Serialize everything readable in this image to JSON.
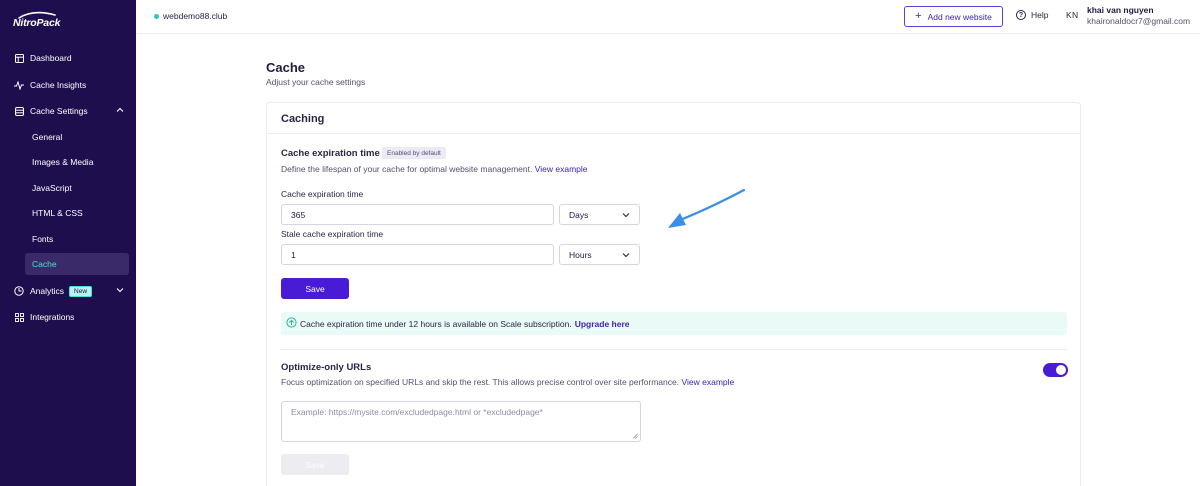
{
  "sidebar": {
    "logo": "NitroPack",
    "items": [
      {
        "label": "Dashboard",
        "icon": "dashboard-icon"
      },
      {
        "label": "Cache Insights",
        "icon": "pulse-icon"
      },
      {
        "label": "Cache Settings",
        "icon": "database-icon"
      },
      {
        "label": "Analytics",
        "icon": "clock-chart-icon",
        "badge": "New"
      },
      {
        "label": "Integrations",
        "icon": "grid-icon"
      }
    ],
    "subitems": [
      "General",
      "Images & Media",
      "JavaScript",
      "HTML & CSS",
      "Fonts",
      "Cache"
    ],
    "active_subitem": "Cache"
  },
  "topbar": {
    "site": "webdemo88.club",
    "add_website": "Add new website",
    "help": "Help",
    "avatar_initials": "KN",
    "user_name": "khai van nguyen",
    "user_email": "khaironaldocr7@gmail.com"
  },
  "page": {
    "title": "Cache",
    "subtitle": "Adjust your cache settings"
  },
  "caching": {
    "title": "Caching",
    "expiration_title": "Cache expiration time",
    "enabled_badge": "Enabled by default",
    "expiration_desc": "Define the lifespan of your cache for optimal website management.",
    "view_example": "View example",
    "expiration_label": "Cache expiration time",
    "expiration_value": "365",
    "expiration_unit": "Days",
    "stale_label": "Stale cache expiration time",
    "stale_value": "1",
    "stale_unit": "Hours",
    "save": "Save",
    "info_text": "Cache expiration time under 12 hours is available on Scale subscription.",
    "upgrade": "Upgrade here"
  },
  "optimize_only": {
    "title": "Optimize-only URLs",
    "desc": "Focus optimization on specified URLs and skip the rest. This allows precise control over site performance.",
    "view_example": "View example",
    "placeholder": "Example: https://mysite.com/excludedpage.html or *excludedpage*",
    "save": "Save",
    "toggle_on": true
  },
  "colors": {
    "sidebar_bg": "#1f0e4e",
    "primary": "#4a1bd6",
    "accent_teal": "#4de0d2",
    "arrow": "#3b8de8"
  }
}
